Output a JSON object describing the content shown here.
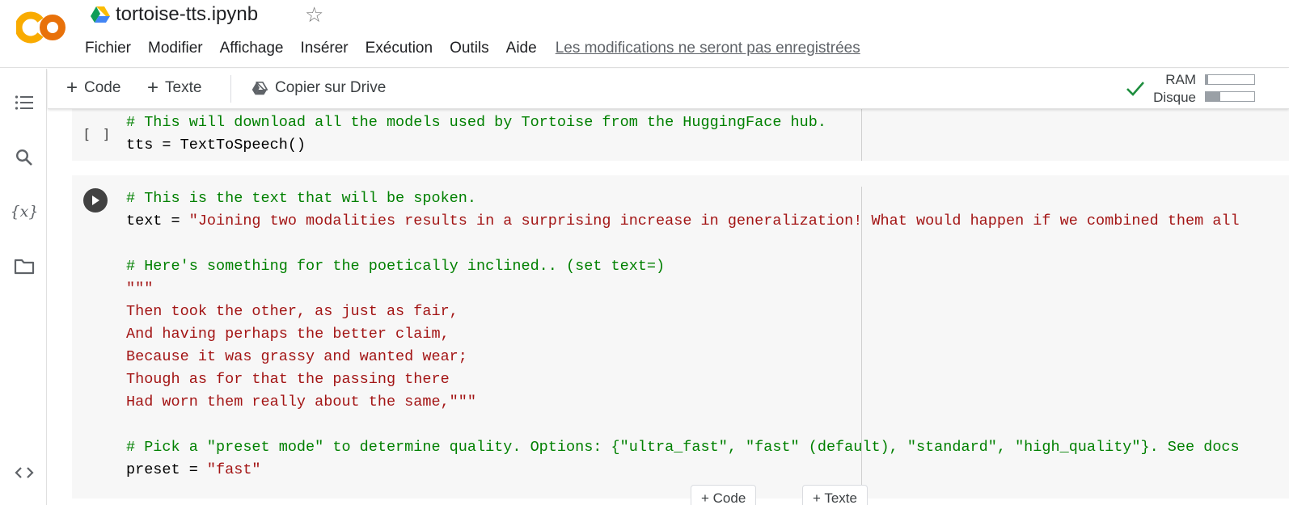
{
  "header": {
    "title": "tortoise-tts.ipynb",
    "menu": [
      "Fichier",
      "Modifier",
      "Affichage",
      "Insérer",
      "Exécution",
      "Outils",
      "Aide"
    ],
    "save_warning": "Les modifications ne seront pas enregistrées"
  },
  "toolbar": {
    "add_code": "Code",
    "add_text": "Texte",
    "copy_drive": "Copier sur Drive",
    "ram_label": "RAM",
    "disk_label": "Disque",
    "ram_usage": 0.05,
    "disk_usage": 0.3
  },
  "sidebar": {
    "icons": [
      "toc-icon",
      "search-icon",
      "variables-icon",
      "folder-icon",
      "code-snippets-icon"
    ]
  },
  "cells": [
    {
      "run_marker": "[ ]",
      "lines": [
        [
          {
            "c": "cm",
            "t": "# This will download all the models used by Tortoise from the HuggingFace hub."
          }
        ],
        [
          {
            "c": "tx",
            "t": "tts = TextToSpeech()"
          }
        ]
      ]
    },
    {
      "run_marker": "",
      "lines": [
        [
          {
            "c": "cm",
            "t": "# This is the text that will be spoken."
          }
        ],
        [
          {
            "c": "tx",
            "t": "text = "
          },
          {
            "c": "st",
            "t": "\"Joining two modalities results in a surprising increase in generalization! What would happen if we combined them all"
          }
        ],
        [],
        [
          {
            "c": "cm",
            "t": "# Here's something for the poetically inclined.. (set text=)"
          }
        ],
        [
          {
            "c": "st",
            "t": "\"\"\""
          }
        ],
        [
          {
            "c": "st",
            "t": "Then took the other, as just as fair,"
          }
        ],
        [
          {
            "c": "st",
            "t": "And having perhaps the better claim,"
          }
        ],
        [
          {
            "c": "st",
            "t": "Because it was grassy and wanted wear;"
          }
        ],
        [
          {
            "c": "st",
            "t": "Though as for that the passing there"
          }
        ],
        [
          {
            "c": "st",
            "t": "Had worn them really about the same,\"\"\""
          }
        ],
        [],
        [
          {
            "c": "cm",
            "t": "# Pick a \"preset mode\" to determine quality. Options: {\"ultra_fast\", \"fast\" (default), \"standard\", \"high_quality\"}. See docs"
          }
        ],
        [
          {
            "c": "tx",
            "t": "preset = "
          },
          {
            "c": "st",
            "t": "\"fast\""
          }
        ]
      ]
    }
  ],
  "add_cell": {
    "code_label": "+ Code",
    "text_label": "+ Texte"
  },
  "colors": {
    "comment": "#008000",
    "string": "#a31515",
    "text": "#000000",
    "logo_orange": "#F9AB00",
    "logo_dark_orange": "#E8710A",
    "check_green": "#1e8e3e"
  }
}
